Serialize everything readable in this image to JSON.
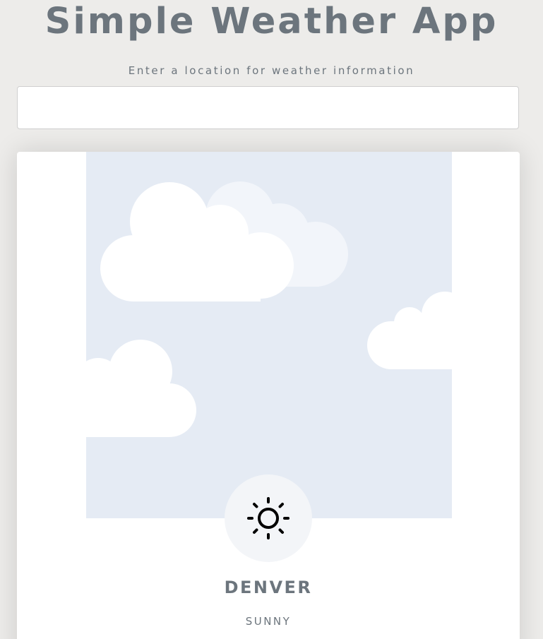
{
  "header": {
    "title": "Simple Weather App",
    "subtitle": "Enter a location for weather information"
  },
  "search": {
    "value": "",
    "placeholder": ""
  },
  "weather": {
    "city": "DENVER",
    "condition": "SUNNY",
    "icon": "sun-icon"
  },
  "colors": {
    "text": "#6c757d",
    "sky": "#e5ebf4",
    "background": "#edecea"
  }
}
